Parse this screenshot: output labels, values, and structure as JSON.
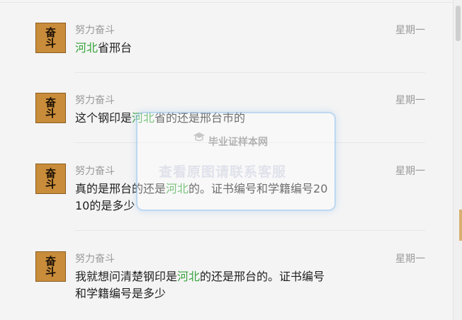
{
  "messages": [
    {
      "sender": "努力奋斗",
      "time": "星期一",
      "avatar_text": [
        "奋",
        "斗"
      ],
      "parts": [
        {
          "t": "河北",
          "hl": true
        },
        {
          "t": "省邢台",
          "hl": false
        }
      ]
    },
    {
      "sender": "努力奋斗",
      "time": "星期一",
      "avatar_text": [
        "奋",
        "斗"
      ],
      "parts": [
        {
          "t": "这个钢印是",
          "hl": false
        },
        {
          "t": "河北",
          "hl": true
        },
        {
          "t": "省的还是邢台市的",
          "hl": false
        }
      ]
    },
    {
      "sender": "努力奋斗",
      "time": "星期一",
      "avatar_text": [
        "奋",
        "斗"
      ],
      "parts": [
        {
          "t": "真的是邢台的还是",
          "hl": false
        },
        {
          "t": "河北",
          "hl": true
        },
        {
          "t": "的。证书编号和学籍编号20\n10的是多少",
          "hl": false
        }
      ]
    },
    {
      "sender": "努力奋斗",
      "time": "星期一",
      "avatar_text": [
        "奋",
        "斗"
      ],
      "parts": [
        {
          "t": "我就想问清楚钢印是",
          "hl": false
        },
        {
          "t": "河北",
          "hl": true
        },
        {
          "t": "的还是邢台的。证书编号\n和学籍编号是多少",
          "hl": false
        }
      ]
    }
  ],
  "watermark": {
    "title": "毕业证样本网",
    "icon": "graduation-cap-icon",
    "subtitle": "查看原图请联系客服"
  },
  "colors": {
    "highlight": "#37a33b",
    "meta": "#9a9a9a",
    "background": "#f4f4f4"
  }
}
